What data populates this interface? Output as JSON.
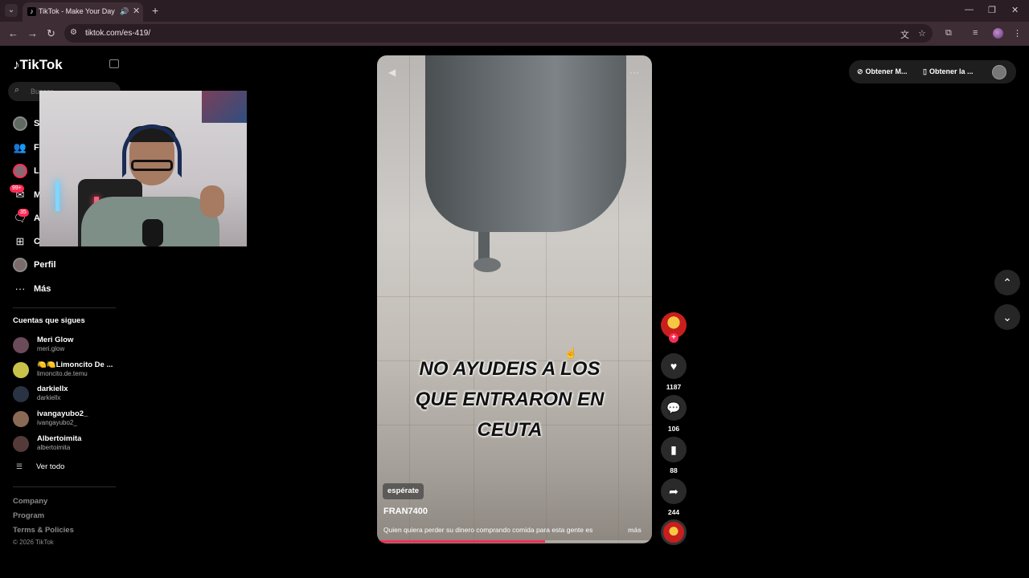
{
  "browser": {
    "tab_title": "TikTok - Make Your Day",
    "url": "tiktok.com/es-419/"
  },
  "sidebar": {
    "logo": "TikTok",
    "search_placeholder": "Buscar",
    "partial_items": [
      {
        "label": "S"
      },
      {
        "label": "F"
      },
      {
        "label": "L"
      },
      {
        "label": "M",
        "badge": "99+"
      },
      {
        "label": "A",
        "badge": "35"
      },
      {
        "label": "C"
      }
    ],
    "items": [
      {
        "label": "Perfil"
      },
      {
        "label": "Más"
      }
    ],
    "following_title": "Cuentas que sigues",
    "following": [
      {
        "name": "Meri Glow",
        "handle": "meri.glow",
        "color": "#6b4a5a"
      },
      {
        "name": "🍋🍋Limoncito De ...",
        "handle": "limoncito.de.temu",
        "color": "#c9c24a"
      },
      {
        "name": "darkiellx",
        "handle": "darkiellx",
        "color": "#2a3344"
      },
      {
        "name": "ivangayubo2_",
        "handle": "ivangayubo2_",
        "color": "#8a6a55"
      },
      {
        "name": "Albertoimita",
        "handle": "albertoimita",
        "color": "#553a3a"
      }
    ],
    "see_all": "Ver todo",
    "footer_links": [
      "Company",
      "Program",
      "Terms & Policies"
    ],
    "copyright": "© 2026 TikTok"
  },
  "video": {
    "caption_lines": [
      "NO AYUDEIS A LOS",
      "QUE ENTRARON EN",
      "CEUTA"
    ],
    "sticker": "espérate",
    "author": "FRAN7400",
    "description": "Quien quiera perder su dinero comprando comida para esta gente es",
    "more": "más",
    "progress": 0.61
  },
  "actions": {
    "likes": "1187",
    "comments": "106",
    "saves": "88",
    "shares": "244"
  },
  "topbar": {
    "get_app_1": "Obtener M...",
    "get_app_2": "Obtener la ..."
  },
  "colors": {
    "accent": "#fe2c55",
    "chrome": "#3f2d36"
  }
}
